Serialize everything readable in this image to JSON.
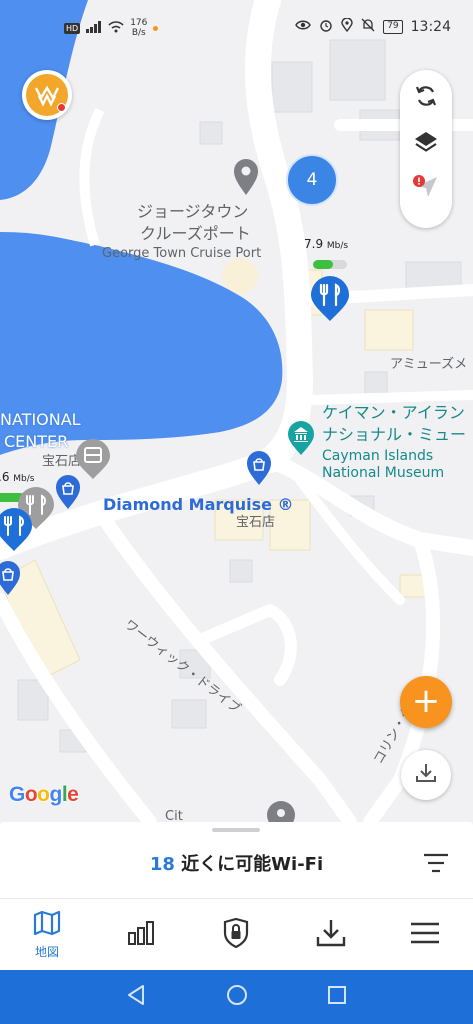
{
  "status_bar": {
    "hd_label": "HD",
    "net_speed_value": "176",
    "net_speed_unit": "B/s",
    "battery": "79",
    "time": "13:24"
  },
  "map": {
    "labels": {
      "cruise_port_jp_1": "ジョージタウン",
      "cruise_port_jp_2": "クルーズポート",
      "cruise_port_en": "George Town Cruise Port",
      "amusement": "アミューズメ",
      "museum_jp_1": "ケイマン・アイラン",
      "museum_jp_2": "ナショナル・ミュー",
      "museum_en_1": "Cayman Islands",
      "museum_en_2": "National Museum",
      "national_1": "NATIONAL",
      "national_2": "CENTER",
      "jewelry_left": "宝石店",
      "diamond": "Diamond Marquise ®",
      "jewelry_center": "宝石店",
      "warwick_drive": "ワーウィック・ドライブ",
      "colin": "コリン・ク",
      "city_partial": "Cit"
    },
    "cluster_count": "4",
    "speed_tags": [
      {
        "value": "7.9",
        "unit": "Mb/s",
        "fill": 0.6
      },
      {
        "value": ".6",
        "unit": "Mb/s",
        "fill": 0.8
      }
    ],
    "google_logo": [
      "G",
      "o",
      "o",
      "g",
      "l",
      "e"
    ],
    "colors": {
      "water": "#4e8ff0",
      "road": "#ffffff",
      "land": "#f1f1f3",
      "pin_blue": "#1f6fd8",
      "pin_gray": "#9e9e9e",
      "accent_orange": "#f7931e"
    }
  },
  "controls": {
    "refresh_icon": "refresh-icon",
    "layers_icon": "layers-icon",
    "locate_icon": "location-arrow-icon"
  },
  "bottom_sheet": {
    "count": "18",
    "title_rest": " 近くに可能Wi-Fi"
  },
  "tabs": [
    {
      "icon": "map-icon",
      "label": "地図",
      "active": true
    },
    {
      "icon": "bar-chart-icon",
      "label": "",
      "active": false
    },
    {
      "icon": "shield-lock-icon",
      "label": "",
      "active": false
    },
    {
      "icon": "download-icon",
      "label": "",
      "active": false
    },
    {
      "icon": "menu-icon",
      "label": "",
      "active": false
    }
  ]
}
